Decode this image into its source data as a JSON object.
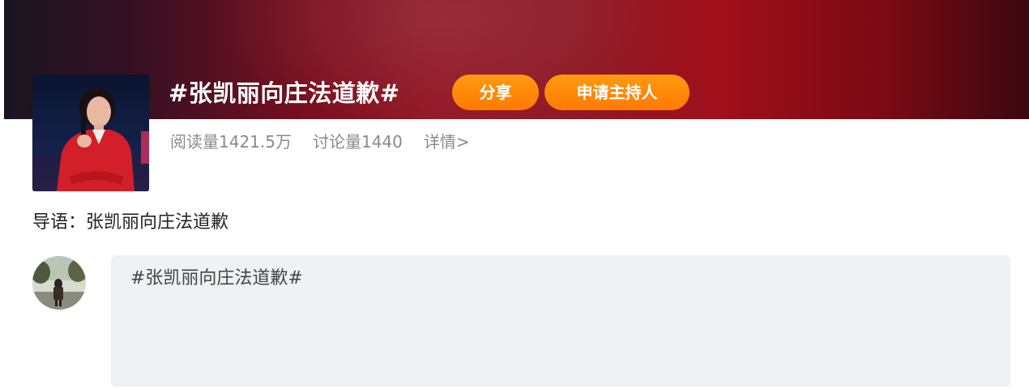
{
  "topic": {
    "title": "#张凯丽向庄法道歉#",
    "share_label": "分享",
    "apply_host_label": "申请主持人"
  },
  "stats": {
    "reads": "阅读量1421.5万",
    "discussions": "讨论量1440",
    "details_link": "详情>"
  },
  "intro": {
    "text": "导语：张凯丽向庄法道歉"
  },
  "composer": {
    "value": "#张凯丽向庄法道歉#"
  },
  "colors": {
    "accent_orange": "#ff8a00",
    "banner_red": "#961826",
    "composer_bg": "#f0f1f5",
    "muted_text": "#8a8a8a"
  }
}
